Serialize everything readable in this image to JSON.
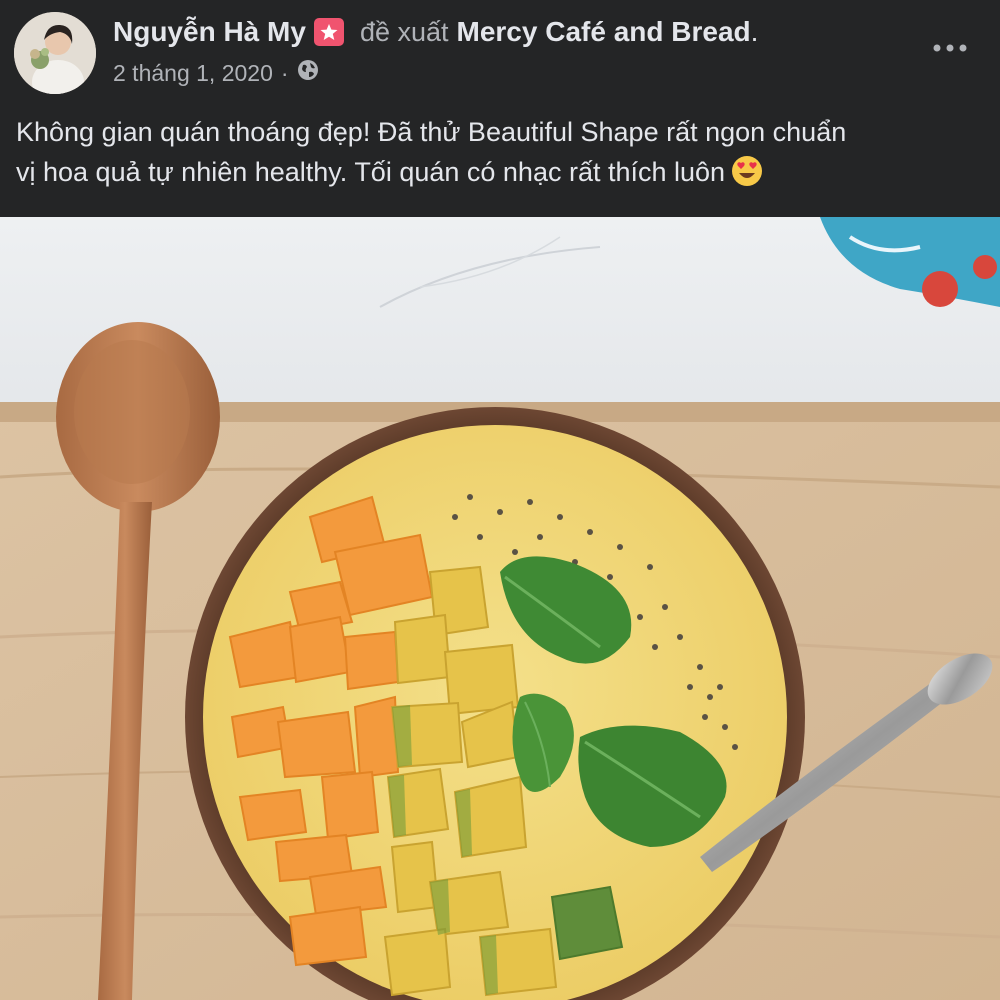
{
  "post": {
    "author": "Nguyễn Hà My",
    "recommends": "đề xuất",
    "page_name": "Mercy Café and Bread",
    "period": ".",
    "date": "2 tháng 1, 2020",
    "separator": "·",
    "audience_icon": "globe-icon",
    "badge_icon": "star-badge-icon",
    "more_icon": "more-options-icon",
    "text_line1": "Không gian quán thoáng đẹp! Đã thử Beautiful Shape rất ngon chuẩn",
    "text_line2": "vị hoa quả tự nhiên healthy. Tối quán có nhạc rất thích luôn",
    "emoji": "heart-eyes-emoji"
  },
  "colors": {
    "header_bg": "#242526",
    "primary_text": "#e4e6eb",
    "secondary_text": "#b0b3b8",
    "badge": "#f0546f"
  }
}
